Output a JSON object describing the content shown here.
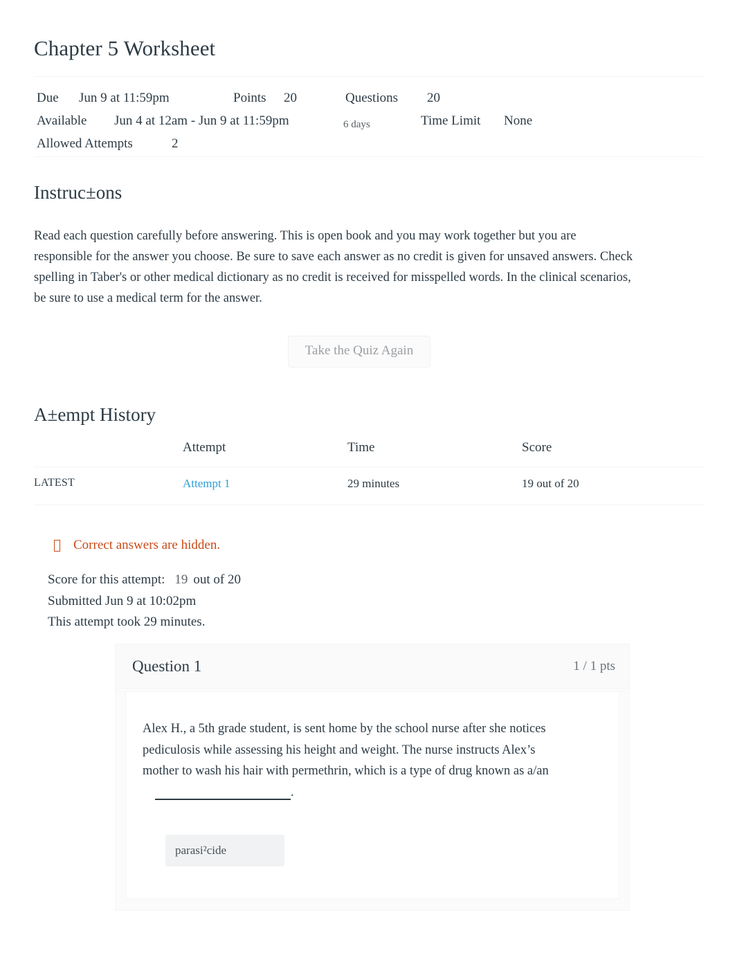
{
  "quiz": {
    "title": "Chapter 5 Worksheet",
    "meta": {
      "due_label": "Due",
      "due_value": "Jun 9 at 11:59pm",
      "points_label": "Points",
      "points_value": "20",
      "questions_label": "Questions",
      "questions_value": "20",
      "available_label": "Available",
      "available_value": "Jun 4 at 12am - Jun 9 at 11:59pm",
      "duration_note": "6 days",
      "time_limit_label": "Time Limit",
      "time_limit_value": "None",
      "allowed_attempts_label": "Allowed Attempts",
      "allowed_attempts_value": "2"
    }
  },
  "instructions": {
    "heading": "Instruc±ons",
    "body": "Read each question carefully before answering. This is open book and you may work together but you are responsible for the answer you choose. Be sure to save each answer as no credit is given for unsaved answers. Check spelling in Taber's or other medical dictionary as no credit is received for misspelled words. In the clinical scenarios, be sure to use a medical term for the answer."
  },
  "actions": {
    "retake_label": "Take the Quiz Again"
  },
  "attempt_history": {
    "heading": "A±empt History",
    "columns": [
      "",
      "Attempt",
      "Time",
      "Score"
    ],
    "rows": [
      {
        "marker": "LATEST",
        "attempt": "Attempt 1",
        "time": "29 minutes",
        "score": "19 out of 20"
      }
    ]
  },
  "notice": {
    "icon": "warning-icon",
    "text": "Correct answers are hidden."
  },
  "attempt_summary": {
    "score_label": "Score for this attempt:",
    "score_value": "19",
    "score_suffix": "out of 20",
    "submitted": "Submitted Jun 9 at 10:02pm",
    "duration": "This attempt took 29 minutes."
  },
  "questions": [
    {
      "title": "Question 1",
      "points": "1 / 1 pts",
      "text_before_blank": "Alex H., a 5th grade student, is sent home by the school nurse after she notices pediculosis while assessing his height and weight. The nurse instructs Alex’s mother to wash his hair with permethrin, which is a type of drug known as a/an",
      "text_after_blank": ".",
      "answer": "parasi²cide"
    }
  ],
  "colors": {
    "link": "#2b9fd8",
    "notice": "#ca4a17",
    "text": "#2d3b45",
    "muted": "#6b7377",
    "chip_bg": "#f1f2f3"
  }
}
